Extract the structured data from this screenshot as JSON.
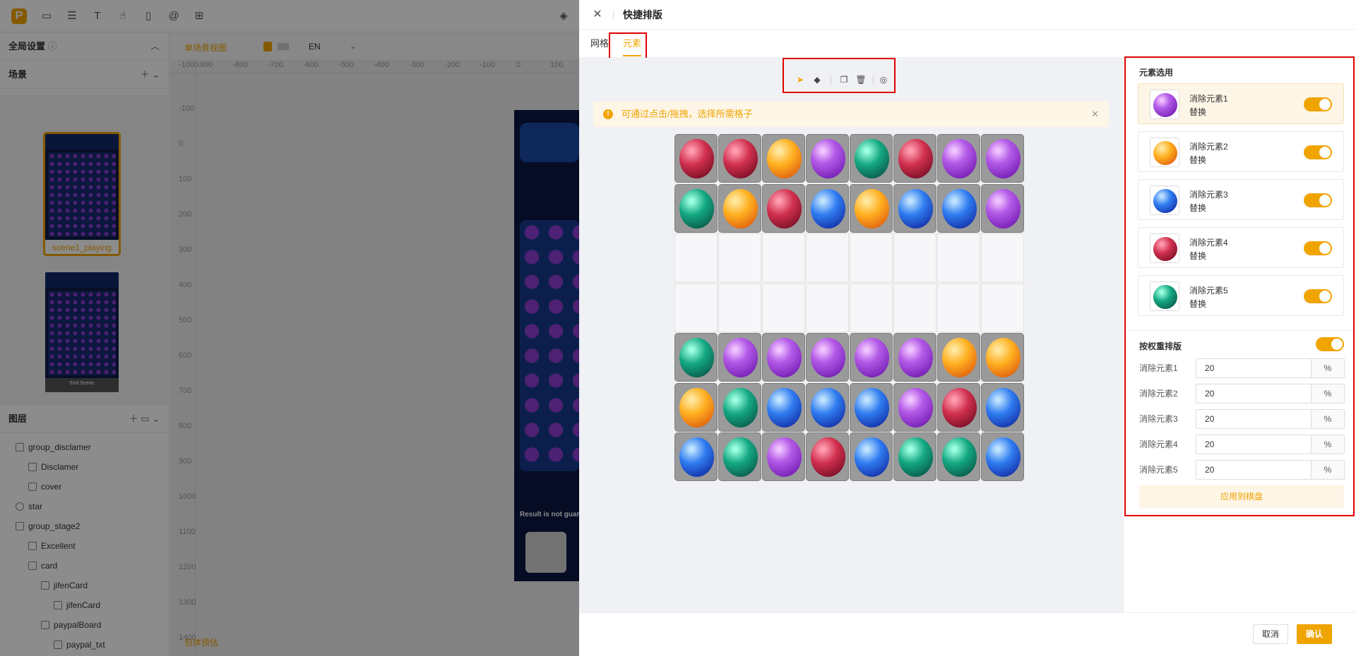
{
  "editor": {
    "global_settings": "全局设置",
    "scenes_title": "场景",
    "scene1_label": "scene1_playing",
    "scene2_label": "End Scene",
    "layers_title": "图层",
    "layers": [
      "group_disclamer",
      "Disclamer",
      "cover",
      "star",
      "group_stage2",
      "Excellent",
      "card",
      "jifenCard",
      "jifenCard",
      "paypalBoard",
      "paypal_txt"
    ],
    "view_label": "单场景视图",
    "lang": "EN",
    "ruler_x": [
      "-1000",
      "-900",
      "-800",
      "-700",
      "-600",
      "-500",
      "-400",
      "-300",
      "-200",
      "-100",
      "0",
      "100"
    ],
    "ruler_y": [
      "-100",
      "0",
      "100",
      "200",
      "300",
      "400",
      "500",
      "600",
      "700",
      "800",
      "900",
      "1000",
      "1100",
      "1200",
      "1300",
      "1400"
    ],
    "bottom_link": "包体预估",
    "phone_bottom_text": "Result is not guar"
  },
  "drawer": {
    "title": "快捷排版",
    "tabs": [
      "网格",
      "元素"
    ],
    "active_tab": "元素",
    "tip": "可通过点击/拖拽，选择所需格子",
    "board": [
      [
        4,
        4,
        2,
        1,
        5,
        4,
        1,
        1
      ],
      [
        5,
        2,
        4,
        3,
        2,
        3,
        3,
        1
      ],
      [
        0,
        0,
        0,
        0,
        0,
        0,
        0,
        0
      ],
      [
        0,
        0,
        0,
        0,
        0,
        0,
        0,
        0
      ],
      [
        5,
        1,
        1,
        1,
        1,
        1,
        2,
        2
      ],
      [
        2,
        5,
        3,
        3,
        3,
        1,
        4,
        3
      ],
      [
        3,
        5,
        1,
        4,
        3,
        5,
        5,
        3
      ]
    ],
    "elements_title": "元素选用",
    "elements": [
      {
        "name": "消除元素1",
        "replace": "替换",
        "type": 1
      },
      {
        "name": "消除元素2",
        "replace": "替换",
        "type": 2
      },
      {
        "name": "消除元素3",
        "replace": "替换",
        "type": 3
      },
      {
        "name": "消除元素4",
        "replace": "替换",
        "type": 4
      },
      {
        "name": "消除元素5",
        "replace": "替换",
        "type": 5
      }
    ],
    "weight_title": "按权重排版",
    "weights": [
      {
        "label": "消除元素1",
        "value": "20",
        "unit": "%"
      },
      {
        "label": "消除元素2",
        "value": "20",
        "unit": "%"
      },
      {
        "label": "消除元素3",
        "value": "20",
        "unit": "%"
      },
      {
        "label": "消除元素4",
        "value": "20",
        "unit": "%"
      },
      {
        "label": "消除元素5",
        "value": "20",
        "unit": "%"
      }
    ],
    "apply_label": "应用到棋盘",
    "cancel_label": "取消",
    "ok_label": "确认"
  },
  "colors": {
    "accent": "#f0a400",
    "highlight": "#e00000"
  }
}
